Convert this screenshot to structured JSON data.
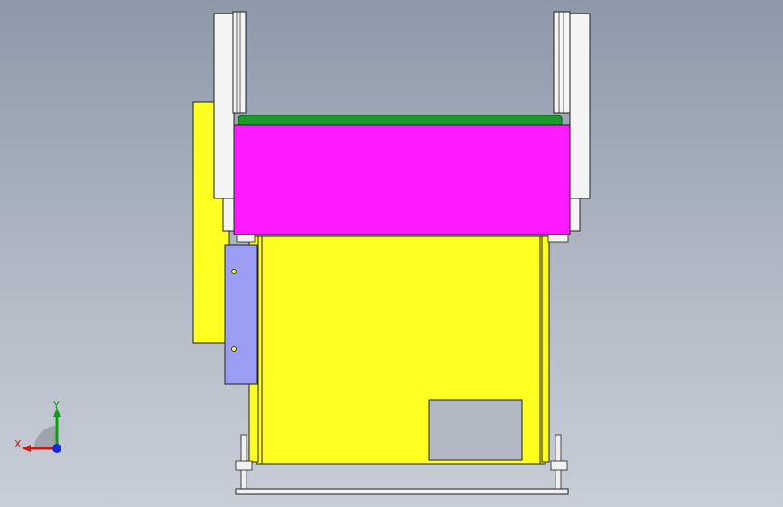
{
  "view": {
    "background_top": "#8e98a8",
    "background_bottom": "#c8ced8"
  },
  "model": {
    "parts": [
      {
        "name": "belt-cover",
        "color": "#ff1aff"
      },
      {
        "name": "roller",
        "color": "#1b9b2a"
      },
      {
        "name": "main-frame",
        "color": "#ffff22"
      },
      {
        "name": "side-plate",
        "color": "#9b9ef2"
      },
      {
        "name": "side-rail",
        "color": "#f4f4f4"
      },
      {
        "name": "base-rod",
        "color": "#f0f0f0"
      }
    ]
  },
  "triad": {
    "x_label": "X",
    "y_label": "Y",
    "x_color": "#d01818",
    "y_color": "#139a13",
    "z_color": "#1a2ad0"
  }
}
